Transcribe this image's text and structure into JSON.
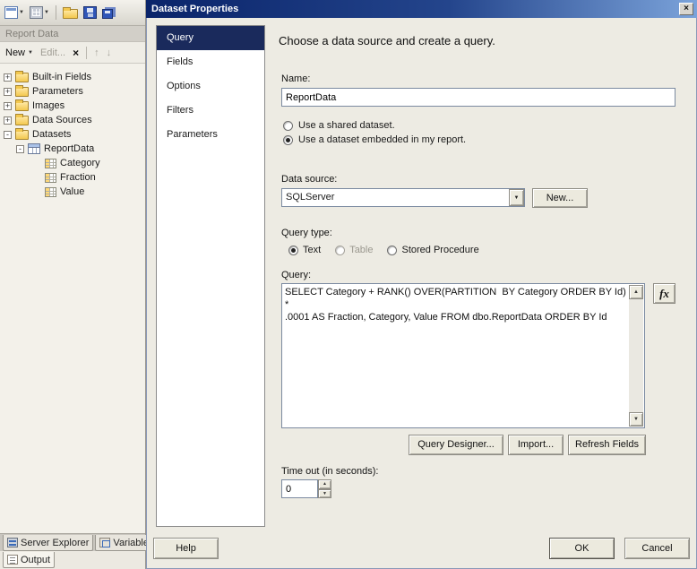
{
  "colors": {
    "titlebar_left": "#0a246a",
    "titlebar_right": "#7ba3da",
    "nav_selected_bg": "#1a2a5c",
    "dialog_bg": "#edebe3"
  },
  "report_data": {
    "title": "Report Data",
    "toolbar": {
      "new": "New",
      "edit": "Edit...",
      "delete": "×",
      "up": "↑",
      "down": "↓"
    },
    "tree": [
      {
        "expander": "+",
        "label": "Built-in Fields"
      },
      {
        "expander": "+",
        "label": "Parameters"
      },
      {
        "expander": "+",
        "label": "Images"
      },
      {
        "expander": "+",
        "label": "Data Sources"
      },
      {
        "expander": "-",
        "label": "Datasets"
      },
      {
        "expander": "-",
        "label": "ReportData"
      },
      {
        "expander": "",
        "label": "Category"
      },
      {
        "expander": "",
        "label": "Fraction"
      },
      {
        "expander": "",
        "label": "Value"
      }
    ],
    "tabs": {
      "server_explorer": "Server Explorer",
      "variables": "Variables",
      "output": "Output"
    }
  },
  "dialog": {
    "title": "Dataset Properties",
    "close_glyph": "×",
    "nav": [
      "Query",
      "Fields",
      "Options",
      "Filters",
      "Parameters"
    ],
    "heading": "Choose a data source and create a query.",
    "name_label": "Name:",
    "name_value": "ReportData",
    "shared_label": "Use a shared dataset.",
    "embedded_label": "Use a dataset embedded in my report.",
    "datasource_label": "Data source:",
    "datasource_value": "SQLServer",
    "new_label": "New...",
    "querytype_label": "Query type:",
    "querytype": {
      "text": "Text",
      "table": "Table",
      "stored_procedure": "Stored Procedure"
    },
    "query_label": "Query:",
    "query_text": "SELECT Category + RANK() OVER(PARTITION  BY Category ORDER BY Id) *\n.0001 AS Fraction, Category, Value FROM dbo.ReportData ORDER BY Id",
    "fx_label": "fx",
    "query_designer_label": "Query Designer...",
    "import_label": "Import...",
    "refresh_fields_label": "Refresh Fields",
    "timeout_label": "Time out (in seconds):",
    "timeout_value": "0",
    "help_label": "Help",
    "ok_label": "OK",
    "cancel_label": "Cancel"
  }
}
